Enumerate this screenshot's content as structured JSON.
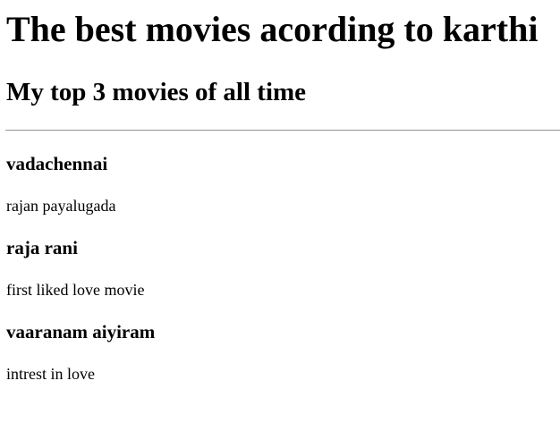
{
  "page": {
    "title": "The best movies acording to karthi",
    "subtitle": "My top 3 movies of all time"
  },
  "movies": [
    {
      "title": "vadachennai",
      "description": "rajan payalugada"
    },
    {
      "title": "raja rani",
      "description": "first liked love movie"
    },
    {
      "title": "vaaranam aiyiram",
      "description": "intrest in love"
    }
  ]
}
